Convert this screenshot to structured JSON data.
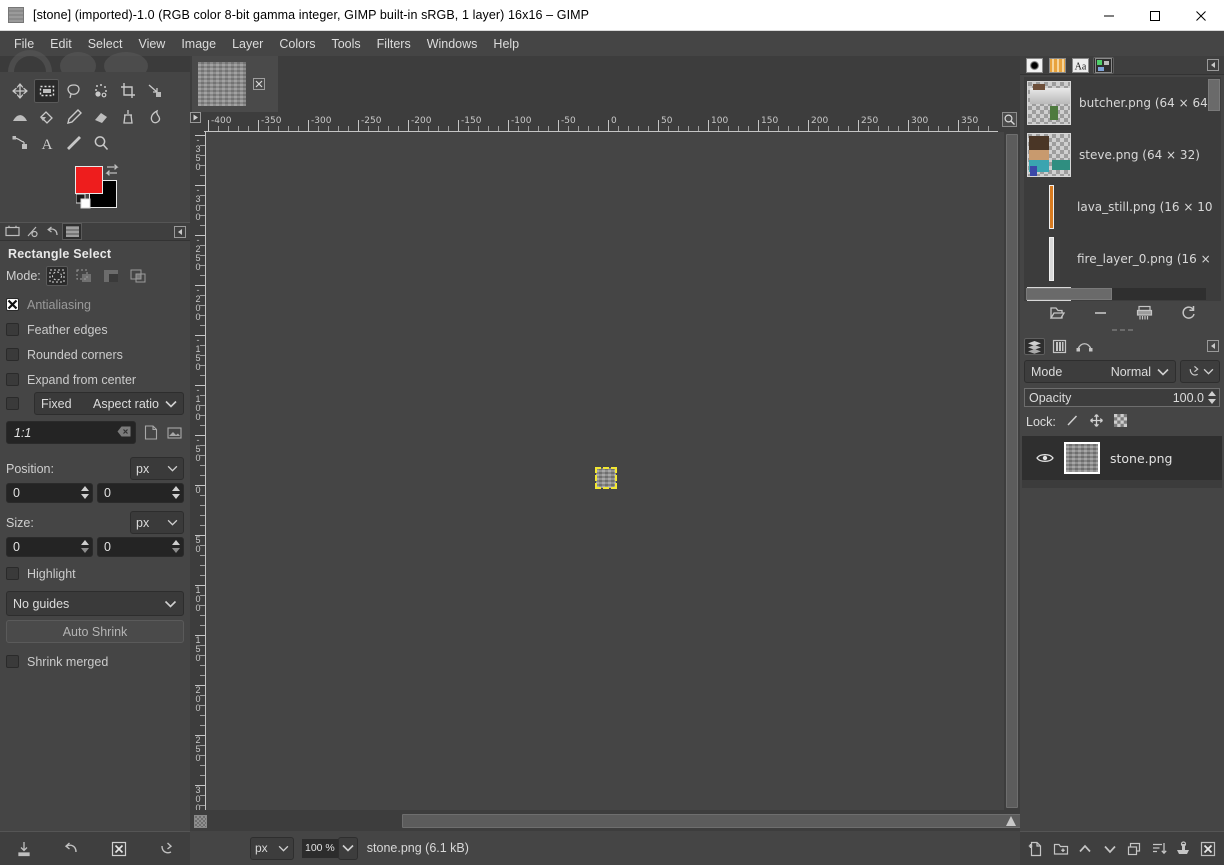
{
  "window": {
    "title": "[stone] (imported)-1.0 (RGB color 8-bit gamma integer, GIMP built-in sRGB, 1 layer) 16x16 – GIMP",
    "minimize_label": "Minimize",
    "maximize_label": "Maximize",
    "close_label": "Close"
  },
  "menubar": {
    "items": [
      {
        "label": "File"
      },
      {
        "label": "Edit"
      },
      {
        "label": "Select"
      },
      {
        "label": "View"
      },
      {
        "label": "Image"
      },
      {
        "label": "Layer"
      },
      {
        "label": "Colors"
      },
      {
        "label": "Tools"
      },
      {
        "label": "Filters"
      },
      {
        "label": "Windows"
      },
      {
        "label": "Help"
      }
    ]
  },
  "toolbox": {
    "tools": [
      {
        "name": "move-tool",
        "selected": false
      },
      {
        "name": "rectangle-select-tool",
        "selected": true
      },
      {
        "name": "free-select-tool",
        "selected": false
      },
      {
        "name": "fuzzy-select-tool",
        "selected": false
      },
      {
        "name": "crop-tool",
        "selected": false
      },
      {
        "name": "transform-tool",
        "selected": false
      },
      {
        "name": "gradient-tool",
        "selected": false
      },
      {
        "name": "bucket-fill-tool",
        "selected": false
      },
      {
        "name": "pencil-tool",
        "selected": false
      },
      {
        "name": "eraser-tool",
        "selected": false
      },
      {
        "name": "clone-tool",
        "selected": false
      },
      {
        "name": "smudge-tool",
        "selected": false
      },
      {
        "name": "paths-tool",
        "selected": false
      },
      {
        "name": "text-tool",
        "selected": false
      },
      {
        "name": "color-picker-tool",
        "selected": false
      },
      {
        "name": "zoom-tool",
        "selected": false
      }
    ],
    "foreground_color": "#ee1d1d",
    "background_color": "#000000"
  },
  "tool_options": {
    "dock_tabs": [
      "tool-options-tab",
      "device-status-tab",
      "undo-history-tab",
      "image-thumb-tab"
    ],
    "title": "Rectangle Select",
    "mode_label": "Mode:",
    "mode_buttons": [
      "replace-selection",
      "add-to-selection",
      "subtract-from-selection",
      "intersect-with-selection"
    ],
    "checkboxes": [
      {
        "label": "Antialiasing",
        "checked": true
      },
      {
        "label": "Feather edges",
        "checked": false
      },
      {
        "label": "Rounded corners",
        "checked": false
      },
      {
        "label": "Expand from center",
        "checked": false
      }
    ],
    "fixed": {
      "checked": false,
      "label": "Fixed",
      "value": "Aspect ratio"
    },
    "ratio_value": "1:1",
    "position_label": "Position:",
    "position_unit": "px",
    "position_x": "0",
    "position_y": "0",
    "size_label": "Size:",
    "size_unit": "px",
    "size_w": "0",
    "size_h": "0",
    "highlight": {
      "label": "Highlight",
      "checked": false
    },
    "guides": "No guides",
    "auto_shrink": "Auto Shrink",
    "shrink_merged": {
      "label": "Shrink merged",
      "checked": false
    },
    "bottom_buttons": [
      "save-tool-preset-icon",
      "restore-tool-preset-icon",
      "delete-tool-preset-icon",
      "reset-tool-options-icon"
    ]
  },
  "image_window": {
    "tab": {
      "name": "stone-image-tab",
      "close_label": "×"
    },
    "ruler_h_labels": [
      "-400",
      "-350",
      "-300",
      "-250",
      "-200",
      "-150",
      "-100",
      "-50",
      "0",
      "50",
      "100",
      "150",
      "200",
      "250",
      "300",
      "350"
    ],
    "ruler_v_labels": [
      "-350",
      "-300",
      "-250",
      "-200",
      "-150",
      "-100",
      "-50",
      "0",
      "50",
      "100",
      "150",
      "200",
      "250",
      "300"
    ],
    "zoom_follow_icon": "zoom-follow-window-icon",
    "quickmask_icon": "quick-mask-toggle-icon",
    "navigation_icon": "navigation-preview-icon"
  },
  "statusbar": {
    "unit": "px",
    "zoom": "100 %",
    "message": "stone.png (6.1 kB)"
  },
  "right_dock": {
    "tabs": [
      "brushes-tab",
      "patterns-tab",
      "fonts-tab",
      "images-tab"
    ],
    "selected_tab": "images-tab",
    "images": [
      {
        "name": "butcher.png (64 × 64)",
        "thumb": "checker-butcher"
      },
      {
        "name": "steve.png (64 × 32)",
        "thumb": "checker-steve"
      },
      {
        "name": "lava_still.png (16 × 10",
        "thumb": "thin-lava"
      },
      {
        "name": "fire_layer_0.png (16 ×",
        "thumb": "thin-fire"
      }
    ],
    "buttons": [
      "raise-view-icon",
      "delete-image-icon",
      "shred-icon",
      "refresh-icon"
    ]
  },
  "layers": {
    "tabs": [
      "layers-tab",
      "channels-tab",
      "paths-tab"
    ],
    "mode_label": "Mode",
    "mode_value": "Normal",
    "opacity_label": "Opacity",
    "opacity_value": "100.0",
    "lock_label": "Lock:",
    "lock_buttons": [
      "lock-pixels-icon",
      "lock-position-icon",
      "lock-alpha-icon"
    ],
    "items": [
      {
        "name": "stone.png",
        "visible": true,
        "selected": true
      }
    ],
    "bottom_buttons": [
      "new-layer-icon",
      "new-layer-group-icon",
      "raise-layer-icon",
      "lower-layer-icon",
      "duplicate-layer-icon",
      "merge-down-icon",
      "anchor-layer-icon",
      "delete-layer-icon"
    ]
  },
  "colors": {
    "window_bg": "#454545",
    "panel_bg": "#3d3d3d",
    "titlebar_bg": "#ffffff",
    "selection_outline": "#f2e733",
    "fg_swatch": "#ee1d1d"
  }
}
